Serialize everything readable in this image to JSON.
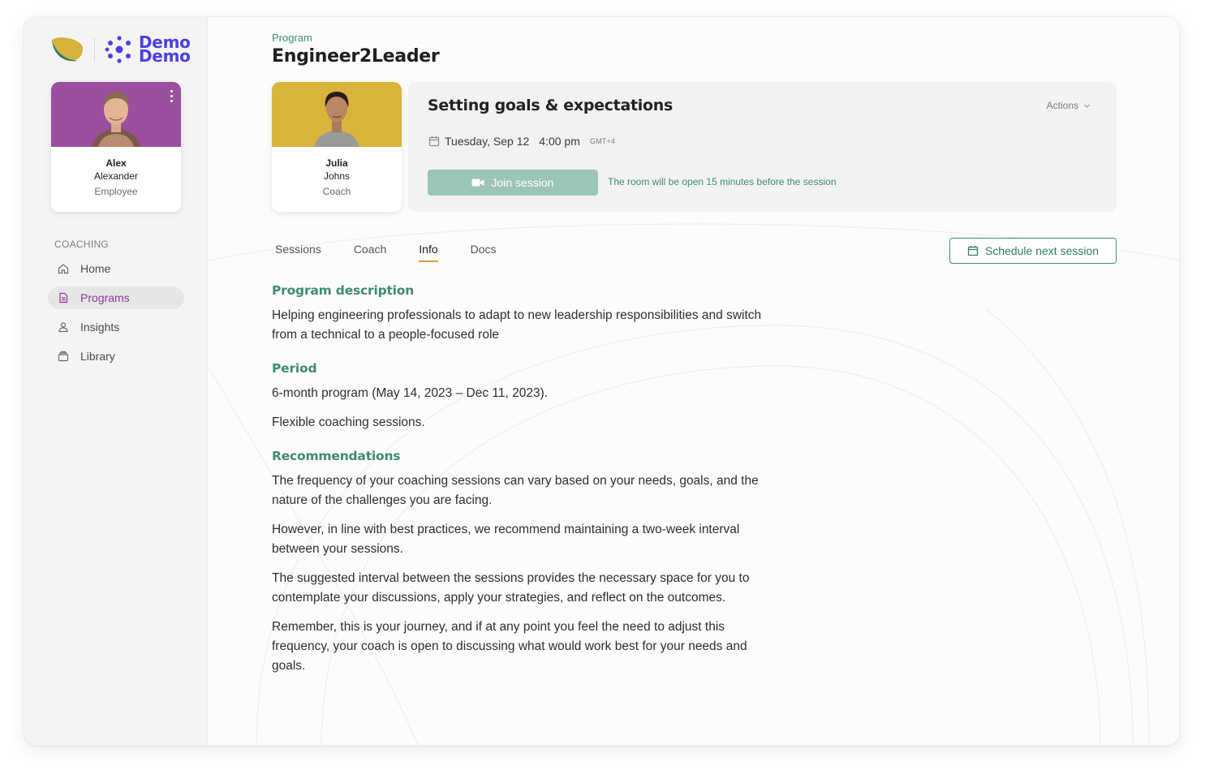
{
  "brand": {
    "name_line1": "Demo",
    "name_line2": "Demo"
  },
  "user": {
    "first_name": "Alex",
    "last_name": "Alexander",
    "role": "Employee",
    "card_color": "#9b4f9e"
  },
  "sidebar": {
    "section_label": "COACHING",
    "items": [
      {
        "label": "Home",
        "icon": "home-icon"
      },
      {
        "label": "Programs",
        "icon": "document-icon",
        "active": true
      },
      {
        "label": "Insights",
        "icon": "person-icon"
      },
      {
        "label": "Library",
        "icon": "archive-icon"
      }
    ]
  },
  "header": {
    "eyebrow": "Program",
    "title": "Engineer2Leader"
  },
  "coach": {
    "first_name": "Julia",
    "last_name": "Johns",
    "role": "Coach",
    "card_color": "#d9b43a"
  },
  "session": {
    "title": "Setting goals & expectations",
    "actions_label": "Actions",
    "date": "Tuesday, Sep 12",
    "time": "4:00 pm",
    "timezone": "GMT+4",
    "join_label": "Join session",
    "room_note": "The room will be open 15 minutes before the session"
  },
  "tabs": [
    {
      "label": "Sessions"
    },
    {
      "label": "Coach"
    },
    {
      "label": "Info",
      "active": true
    },
    {
      "label": "Docs"
    }
  ],
  "schedule_label": "Schedule next session",
  "info": {
    "description_heading": "Program description",
    "description_text": "Helping engineering professionals to adapt to new leadership responsibilities and switch from a technical to a people-focused role",
    "period_heading": "Period",
    "period_text_1": "6-month program (May 14, 2023 – Dec 11, 2023).",
    "period_text_2": "Flexible coaching sessions.",
    "recommendations_heading": "Recommendations",
    "recommendations": [
      "The frequency of your coaching sessions can vary based on your needs, goals, and the nature of the challenges you are facing.",
      "However, in line with best practices, we recommend maintaining a two-week interval between your sessions.",
      "The suggested interval between the sessions provides the necessary space for you to contemplate your discussions, apply your strategies, and reflect on the outcomes.",
      "Remember, this is your journey, and if at any point you feel the need to adjust this frequency, your coach is open to discussing what would work best for your needs and goals."
    ]
  },
  "colors": {
    "accent_green": "#3f8a72",
    "accent_purple": "#8a3a92",
    "tab_underline": "#d4a833",
    "brand_blue": "#4b3fe0"
  }
}
